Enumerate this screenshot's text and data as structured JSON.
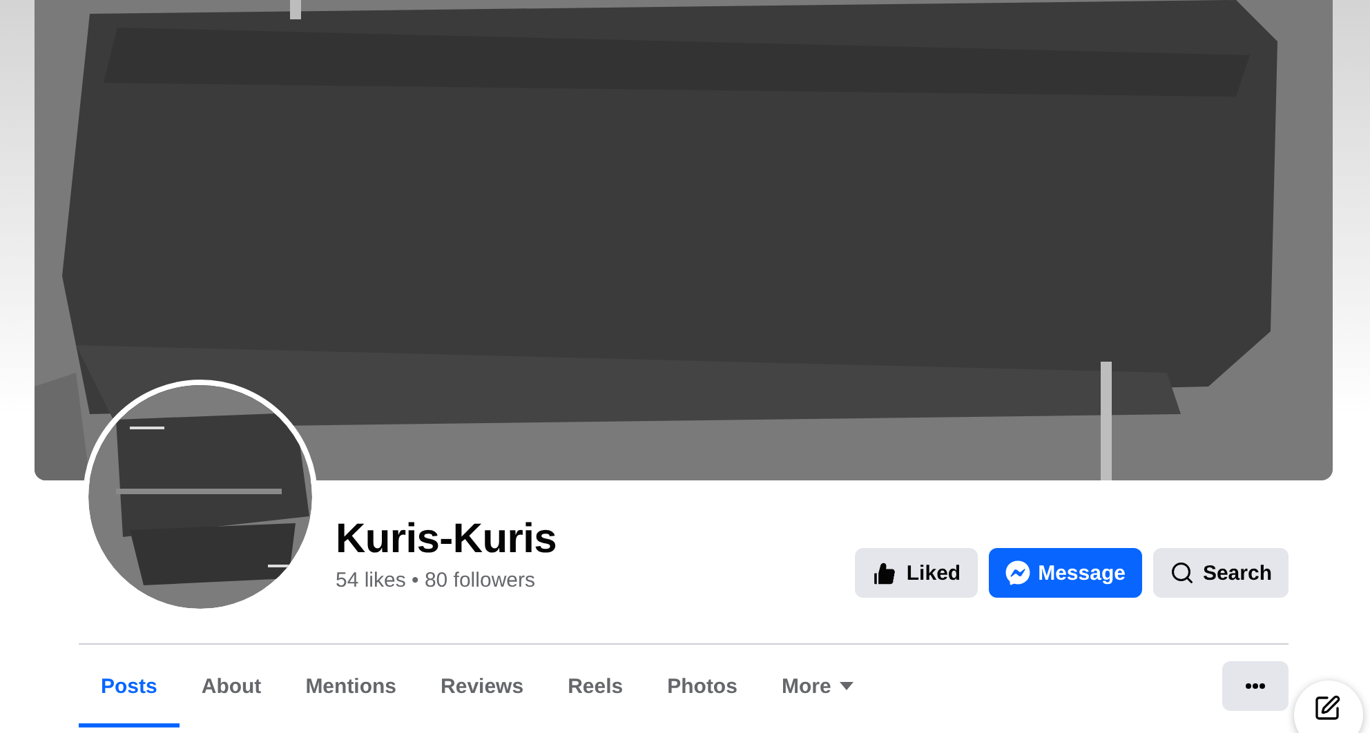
{
  "profile": {
    "name": "Kuris-Kuris",
    "stats": "54 likes • 80 followers"
  },
  "actions": [
    {
      "kind": "liked",
      "label": "Liked"
    },
    {
      "kind": "message",
      "label": "Message"
    },
    {
      "kind": "search",
      "label": "Search"
    }
  ],
  "tabs": [
    {
      "label": "Posts",
      "selected": true,
      "dropdown": false
    },
    {
      "label": "About",
      "selected": false,
      "dropdown": false
    },
    {
      "label": "Mentions",
      "selected": false,
      "dropdown": false
    },
    {
      "label": "Reviews",
      "selected": false,
      "dropdown": false
    },
    {
      "label": "Reels",
      "selected": false,
      "dropdown": false
    },
    {
      "label": "Photos",
      "selected": false,
      "dropdown": false
    },
    {
      "label": "More",
      "selected": false,
      "dropdown": true
    }
  ]
}
